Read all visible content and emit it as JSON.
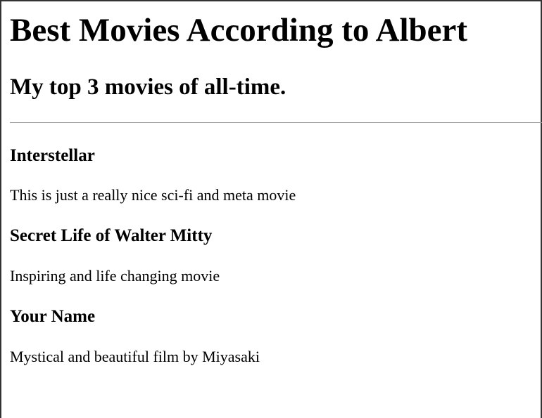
{
  "page": {
    "title": "Best Movies According to Albert",
    "subtitle": "My top 3 movies of all-time."
  },
  "movies": [
    {
      "title": "Interstellar",
      "description": "This is just a really nice sci-fi and meta movie"
    },
    {
      "title": "Secret Life of Walter Mitty",
      "description": "Inspiring and life changing movie"
    },
    {
      "title": "Your Name",
      "description": "Mystical and beautiful film by Miyasaki"
    }
  ]
}
